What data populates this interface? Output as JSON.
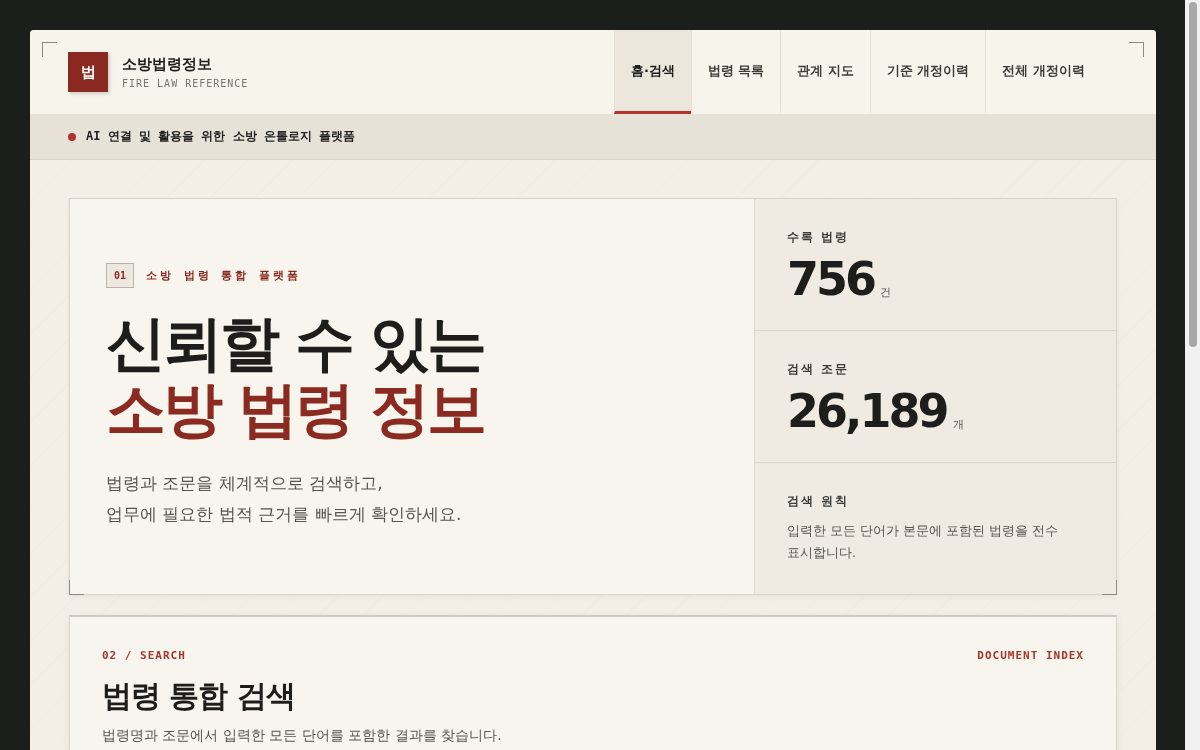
{
  "brand": {
    "logo": "법",
    "name": "소방법령정보",
    "subtitle": "FIRE LAW REFERENCE"
  },
  "nav": [
    {
      "label": "홈·검색",
      "selected": true
    },
    {
      "label": "법령 목록",
      "selected": false
    },
    {
      "label": "관계 지도",
      "selected": false
    },
    {
      "label": "기준 개정이력",
      "selected": false
    },
    {
      "label": "전체 개정이력",
      "selected": false
    }
  ],
  "notice": "AI 연결 및 활용을 위한 소방 온톨로지 플랫폼",
  "hero": {
    "index": "01",
    "eyebrow": "소방 법령 통합 플랫폼",
    "title_line_1": "신뢰할 수 있는",
    "title_line_2": "소방 법령 정보",
    "description_lines": [
      "법령과 조문을 체계적으로 검색하고,",
      "업무에 필요한 법적 근거를 빠르게 확인하세요."
    ]
  },
  "stats": [
    {
      "kind": "number",
      "label": "수록 법령",
      "value": "756",
      "unit": "건"
    },
    {
      "kind": "number",
      "label": "검색 조문",
      "value": "26,189",
      "unit": "개"
    },
    {
      "kind": "text",
      "label": "검색 원칙",
      "text": "입력한 모든 단어가 본문에 포함된 법령을 전수 표시합니다."
    }
  ],
  "search": {
    "section": "02 / SEARCH",
    "tag": "DOCUMENT INDEX",
    "title": "법령 통합 검색",
    "description": "법령명과 조문에서 입력한 모든 단어를 포함한 결과를 찾습니다."
  }
}
